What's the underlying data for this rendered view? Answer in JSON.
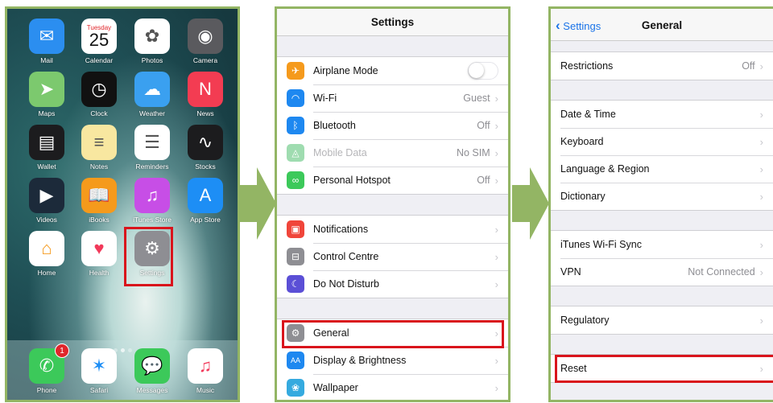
{
  "home": {
    "apps": [
      {
        "label": "Mail",
        "icon": "mail-icon",
        "color": "#2b8ef0",
        "glyph": "✉"
      },
      {
        "label": "Calendar",
        "icon": "calendar-icon",
        "color": "#ffffff",
        "glyph": ""
      },
      {
        "label": "Photos",
        "icon": "photos-icon",
        "color": "#ffffff",
        "glyph": "✿"
      },
      {
        "label": "Camera",
        "icon": "camera-icon",
        "color": "#5a5a5e",
        "glyph": "◉"
      },
      {
        "label": "Maps",
        "icon": "maps-icon",
        "color": "#7cc96e",
        "glyph": "➤"
      },
      {
        "label": "Clock",
        "icon": "clock-icon",
        "color": "#111111",
        "glyph": "◷"
      },
      {
        "label": "Weather",
        "icon": "weather-icon",
        "color": "#3aa0f0",
        "glyph": "☁"
      },
      {
        "label": "News",
        "icon": "news-icon",
        "color": "#f33c52",
        "glyph": "N"
      },
      {
        "label": "Wallet",
        "icon": "wallet-icon",
        "color": "#1c1c1e",
        "glyph": "▤"
      },
      {
        "label": "Notes",
        "icon": "notes-icon",
        "color": "#f8e7a0",
        "glyph": "≡"
      },
      {
        "label": "Reminders",
        "icon": "reminders-icon",
        "color": "#ffffff",
        "glyph": "☰"
      },
      {
        "label": "Stocks",
        "icon": "stocks-icon",
        "color": "#1c1c1e",
        "glyph": "∿"
      },
      {
        "label": "Videos",
        "icon": "videos-icon",
        "color": "#1c2a3a",
        "glyph": "▶"
      },
      {
        "label": "iBooks",
        "icon": "ibooks-icon",
        "color": "#f59a1c",
        "glyph": "📖"
      },
      {
        "label": "iTunes Store",
        "icon": "itunes-store-icon",
        "color": "#c74ee6",
        "glyph": "♫"
      },
      {
        "label": "App Store",
        "icon": "app-store-icon",
        "color": "#1d8ef5",
        "glyph": "A"
      },
      {
        "label": "Home",
        "icon": "home-icon",
        "color": "#ffffff",
        "glyph": "⌂"
      },
      {
        "label": "Health",
        "icon": "health-icon",
        "color": "#ffffff",
        "glyph": "♥"
      },
      {
        "label": "Settings",
        "icon": "settings-icon",
        "color": "#8e8e93",
        "glyph": "⚙"
      }
    ],
    "calendar_day": "Tuesday",
    "calendar_date": "25",
    "dock": [
      {
        "label": "Phone",
        "icon": "phone-icon",
        "color": "#3cc95a",
        "glyph": "✆",
        "badge": "1"
      },
      {
        "label": "Safari",
        "icon": "safari-icon",
        "color": "#ffffff",
        "glyph": "✶"
      },
      {
        "label": "Messages",
        "icon": "messages-icon",
        "color": "#3cc95a",
        "glyph": "💬"
      },
      {
        "label": "Music",
        "icon": "music-icon",
        "color": "#ffffff",
        "glyph": "♫"
      }
    ]
  },
  "settings": {
    "title": "Settings",
    "group1": [
      {
        "label": "Airplane Mode",
        "icon": "airplane-icon",
        "color": "#f59a1c",
        "glyph": "✈",
        "value": "",
        "toggle": true
      },
      {
        "label": "Wi-Fi",
        "icon": "wifi-icon",
        "color": "#1e88f0",
        "glyph": "◠",
        "value": "Guest"
      },
      {
        "label": "Bluetooth",
        "icon": "bluetooth-icon",
        "color": "#1e88f0",
        "glyph": "ᛒ",
        "value": "Off"
      },
      {
        "label": "Mobile Data",
        "icon": "mobile-data-icon",
        "color": "#9fdcb0",
        "glyph": "◬",
        "value": "No SIM",
        "dim": true
      },
      {
        "label": "Personal Hotspot",
        "icon": "hotspot-icon",
        "color": "#3cc95a",
        "glyph": "∞",
        "value": "Off"
      }
    ],
    "group2": [
      {
        "label": "Notifications",
        "icon": "notifications-icon",
        "color": "#f0453a",
        "glyph": "▣",
        "value": ""
      },
      {
        "label": "Control Centre",
        "icon": "control-centre-icon",
        "color": "#8e8e93",
        "glyph": "⊟",
        "value": ""
      },
      {
        "label": "Do Not Disturb",
        "icon": "do-not-disturb-icon",
        "color": "#5b4fd6",
        "glyph": "☾",
        "value": ""
      }
    ],
    "group3": [
      {
        "label": "General",
        "icon": "general-icon",
        "color": "#8e8e93",
        "glyph": "⚙",
        "value": ""
      },
      {
        "label": "Display & Brightness",
        "icon": "display-icon",
        "color": "#1e88f0",
        "glyph": "AA",
        "value": ""
      },
      {
        "label": "Wallpaper",
        "icon": "wallpaper-icon",
        "color": "#35aadf",
        "glyph": "❀",
        "value": ""
      }
    ]
  },
  "general": {
    "back_label": "Settings",
    "title": "General",
    "group1": [
      {
        "label": "Restrictions",
        "value": "Off"
      }
    ],
    "group2": [
      {
        "label": "Date & Time",
        "value": ""
      },
      {
        "label": "Keyboard",
        "value": ""
      },
      {
        "label": "Language & Region",
        "value": ""
      },
      {
        "label": "Dictionary",
        "value": ""
      }
    ],
    "group3": [
      {
        "label": "iTunes Wi-Fi Sync",
        "value": ""
      },
      {
        "label": "VPN",
        "value": "Not Connected"
      }
    ],
    "group4": [
      {
        "label": "Regulatory",
        "value": ""
      }
    ],
    "group5": [
      {
        "label": "Reset",
        "value": ""
      }
    ]
  },
  "colors": {
    "highlight": "#d9141c",
    "arrow": "#93b564",
    "link": "#1a73e8"
  }
}
